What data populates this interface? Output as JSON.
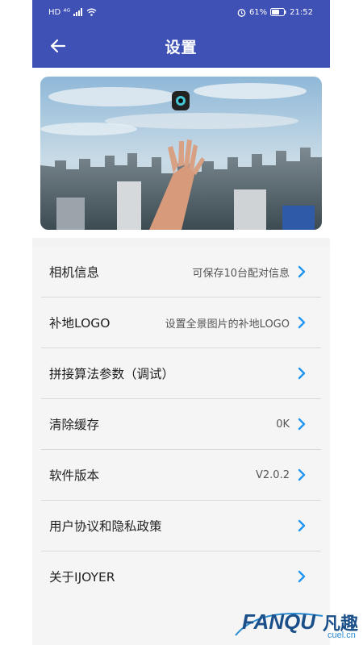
{
  "status_bar": {
    "left_text": "HD ⁴ᴳ",
    "battery_percent": "61%",
    "time": "21:52"
  },
  "app_bar": {
    "title": "设置"
  },
  "settings": [
    {
      "label": "相机信息",
      "value": "可保存10台配对信息"
    },
    {
      "label": "补地LOGO",
      "value": "设置全景图片的补地LOGO"
    },
    {
      "label": "拼接算法参数（调试）",
      "value": ""
    },
    {
      "label": "清除缓存",
      "value": "0K"
    },
    {
      "label": "软件版本",
      "value": "V2.0.2"
    },
    {
      "label": "用户协议和隐私政策",
      "value": ""
    },
    {
      "label": "关于IJOYER",
      "value": ""
    }
  ],
  "watermark": {
    "brand": "FANQU",
    "brand_cn": "凡趣",
    "url": "cuel.cn"
  },
  "colors": {
    "primary": "#3f51b5",
    "chevron": "#2196f3",
    "background": "#f5f5f5"
  }
}
